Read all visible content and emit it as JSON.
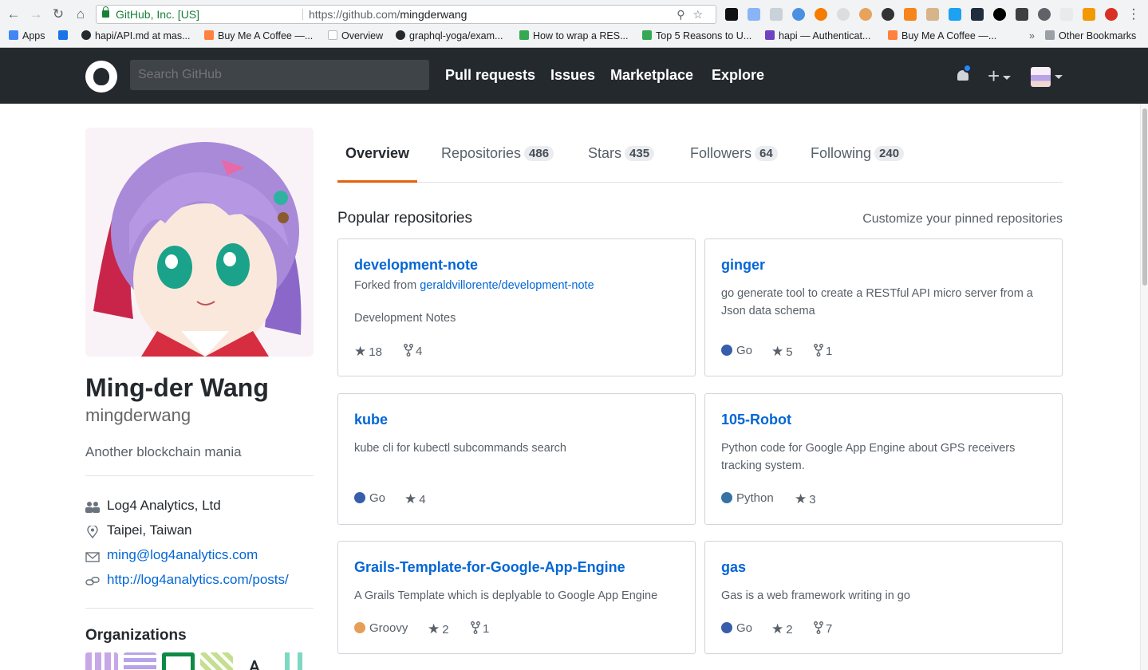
{
  "browser": {
    "site_identity": "GitHub, Inc. [US]",
    "url_prefix": "https://github.com/",
    "url_path": "mingderwang",
    "bookmarks": [
      {
        "label": "Apps",
        "color": "#4285f4"
      },
      {
        "label": "hapi/API.md at mas...",
        "color": "#24292e"
      },
      {
        "label": "Buy Me A Coffee —...",
        "color": "#ff813f"
      },
      {
        "label": "Overview",
        "color": "#ffffff"
      },
      {
        "label": "graphql-yoga/exam...",
        "color": "#24292e"
      },
      {
        "label": "How to wrap a RES...",
        "color": "#34a853"
      },
      {
        "label": "Top 5 Reasons to U...",
        "color": "#34a853"
      },
      {
        "label": "hapi — Authenticat...",
        "color": "#6f42c1"
      },
      {
        "label": "Buy Me A Coffee —...",
        "color": "#ff813f"
      }
    ],
    "other_bookmarks": "Other Bookmarks",
    "more_glyph": "»"
  },
  "header": {
    "search_placeholder": "Search GitHub",
    "nav": [
      "Pull requests",
      "Issues",
      "Marketplace",
      "Explore"
    ],
    "plus_glyph": "+"
  },
  "profile": {
    "name": "Ming-der Wang",
    "login": "mingderwang",
    "bio": "Another blockchain mania",
    "company": "Log4 Analytics, Ltd",
    "location": "Taipei, Taiwan",
    "email": "ming@log4analytics.com",
    "website": "http://log4analytics.com/posts/",
    "organizations_title": "Organizations"
  },
  "tabs": [
    {
      "label": "Overview",
      "count": null
    },
    {
      "label": "Repositories",
      "count": "486"
    },
    {
      "label": "Stars",
      "count": "435"
    },
    {
      "label": "Followers",
      "count": "64"
    },
    {
      "label": "Following",
      "count": "240"
    }
  ],
  "pinned": {
    "title": "Popular repositories",
    "customize": "Customize your pinned repositories",
    "repos": [
      {
        "name": "development-note",
        "fork_prefix": "Forked from ",
        "fork_source": "geraldvillorente/development-note",
        "description": "Development Notes",
        "language": "",
        "lang_color": "",
        "stars": "18",
        "forks": "4"
      },
      {
        "name": "ginger",
        "description": "go generate tool to create a RESTful API micro server from a Json data schema",
        "language": "Go",
        "lang_color": "#375eab",
        "stars": "5",
        "forks": "1"
      },
      {
        "name": "kube",
        "description": "kube cli for kubectl subcommands search",
        "language": "Go",
        "lang_color": "#375eab",
        "stars": "4",
        "forks": ""
      },
      {
        "name": "105-Robot",
        "description": "Python code for Google App Engine about GPS receivers tracking system.",
        "language": "Python",
        "lang_color": "#3572A5",
        "stars": "3",
        "forks": ""
      },
      {
        "name": "Grails-Template-for-Google-App-Engine",
        "description": "A Grails Template which is deplyable to Google App Engine",
        "language": "Groovy",
        "lang_color": "#e69f56",
        "stars": "2",
        "forks": "1"
      },
      {
        "name": "gas",
        "description": "Gas is a web framework writing in go",
        "language": "Go",
        "lang_color": "#375eab",
        "stars": "2",
        "forks": "7"
      }
    ]
  },
  "colors": {
    "header_bg": "#24292e",
    "link": "#0366d6",
    "tab_accent": "#e36209",
    "notification_dot": "#2188ff"
  }
}
